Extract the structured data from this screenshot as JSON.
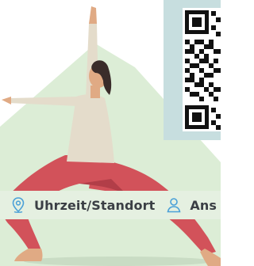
{
  "colors": {
    "mint_background": "#dcedd6",
    "info_bar": "#e5f0e1",
    "qr_frame": "#c7dedf",
    "shirt": "#e4dccb",
    "pants": "#d2525a",
    "skin": "#e0aa84",
    "hair": "#3a2c2a",
    "icon_accent": "#4aa0d8",
    "text": "#3b3f45"
  },
  "qr_code": {
    "icon": "qr-code"
  },
  "illustration": {
    "subject": "yoga-warrior-pose-figure"
  },
  "info_bar": {
    "items": [
      {
        "icon": "location-pin-icon",
        "label": "Uhrzeit/Standort"
      },
      {
        "icon": "person-icon",
        "label": "Ans"
      }
    ]
  }
}
